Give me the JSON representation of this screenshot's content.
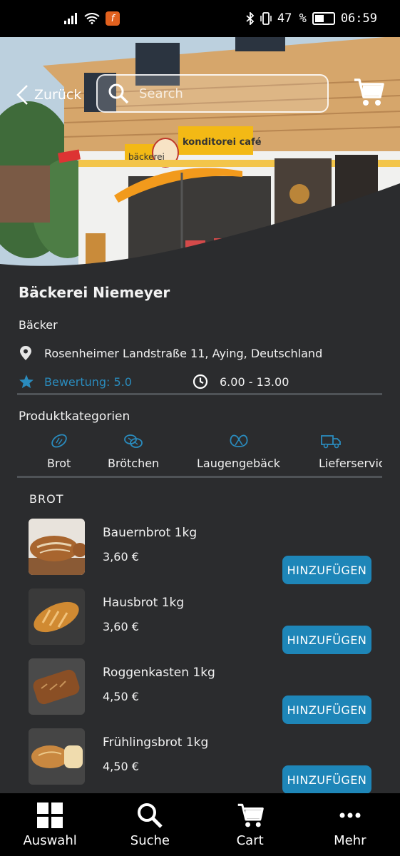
{
  "status_bar": {
    "battery": "47 %",
    "time": "06:59"
  },
  "header": {
    "back_label": "Zurück",
    "search_placeholder": "Search"
  },
  "shop": {
    "name": "Bäckerei Niemeyer",
    "type": "Bäcker",
    "address": "Rosenheimer Landstraße 11, Aying, Deutschland",
    "rating": "Bewertung: 5.0",
    "hours": "6.00 - 13.00"
  },
  "hero": {
    "sign_left": "bäckerei",
    "sign_right": "konditorei café"
  },
  "categories": {
    "title": "Produktkategorien",
    "items": [
      {
        "label": "Brot",
        "icon": "bread-icon"
      },
      {
        "label": "Brötchen",
        "icon": "rolls-icon"
      },
      {
        "label": "Laugengebäck",
        "icon": "pretzel-icon"
      },
      {
        "label": "Lieferservice",
        "icon": "delivery-truck-icon"
      }
    ]
  },
  "section": {
    "label": "BROT"
  },
  "products": [
    {
      "name": "Bauernbrot 1kg",
      "price": "3,60 €",
      "button": "HINZUFÜGEN"
    },
    {
      "name": "Hausbrot 1kg",
      "price": "3,60 €",
      "button": "HINZUFÜGEN"
    },
    {
      "name": "Roggenkasten 1kg",
      "price": "4,50 €",
      "button": "HINZUFÜGEN"
    },
    {
      "name": "Frühlingsbrot 1kg",
      "price": "4,50 €",
      "button": "HINZUFÜGEN"
    }
  ],
  "bottom_nav": [
    {
      "label": "Auswahl",
      "icon": "grid-icon"
    },
    {
      "label": "Suche",
      "icon": "search-icon"
    },
    {
      "label": "Cart",
      "icon": "cart-icon"
    },
    {
      "label": "Mehr",
      "icon": "more-icon"
    }
  ],
  "colors": {
    "accent": "#1e86b8",
    "background": "#2b2c2e",
    "rating": "#2a8bbd"
  }
}
